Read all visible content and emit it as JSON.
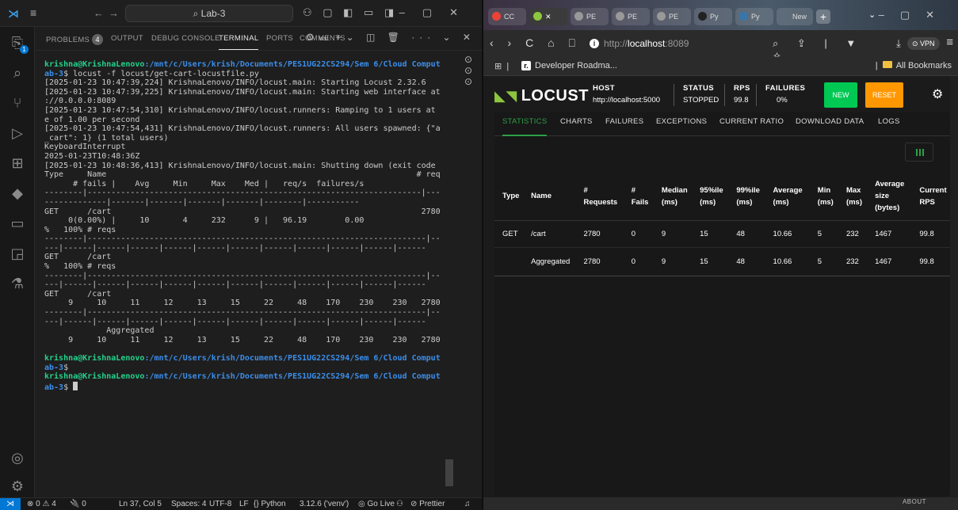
{
  "vscode": {
    "search": "Lab-3",
    "panel_tabs": [
      {
        "label": "PROBLEMS",
        "badge": "4"
      },
      {
        "label": "OUTPUT"
      },
      {
        "label": "DEBUG CONSOLE"
      },
      {
        "label": "TERMINAL"
      },
      {
        "label": "PORTS"
      },
      {
        "label": "COMMENTS"
      }
    ],
    "terminal_shell": "wsl",
    "prompt_user": "krishna@KrishnaLenovo",
    "prompt_path": ":/mnt/c/Users/krish/Documents/PES1UG22CS294/Sem 6/Cloud Computing/L",
    "prompt_path_cont": "ab-3",
    "prompt_suffix": "$ ",
    "command": "locust -f locust/get-cart-locustfile.py",
    "output_lines": [
      "[2025-01-23 10:47:39,224] KrishnaLenovo/INFO/locust.main: Starting Locust 2.32.6",
      "[2025-01-23 10:47:39,225] KrishnaLenovo/INFO/locust.main: Starting web interface at http",
      "://0.0.0.0:8089",
      "[2025-01-23 10:47:54,310] KrishnaLenovo/INFO/locust.runners: Ramping to 1 users at a rat",
      "e of 1.00 per second",
      "[2025-01-23 10:47:54,431] KrishnaLenovo/INFO/locust.runners: All users spawned: {\"add_to",
      "_cart\": 1} (1 total users)",
      "KeyboardInterrupt",
      "2025-01-23T10:48:36Z",
      "[2025-01-23 10:48:36,413] KrishnaLenovo/INFO/locust.main: Shutting down (exit code 0)",
      "Type     Name                                                                 # reqs",
      "      # fails |    Avg     Min     Max    Med |   req/s  failures/s",
      "--------|----------------------------------------------------------------------|-------|",
      "-------------|-------|-------|-------|-------|--------|-----------",
      "GET      /cart                                                                 2780",
      "     0(0.00%) |     10       4     232      9 |   96.19        0.00",
      "%   100% # reqs",
      "--------|-----------------------------------------------------------------------|----",
      "---|------|------|------|------|------|------|------|------|------|------|------",
      "GET      /cart",
      "%   100% # reqs",
      "--------|-----------------------------------------------------------------------|----",
      "---|------|------|------|------|------|------|------|------|------|------|------",
      "GET      /cart",
      "     9     10     11     12     13     15     22     48    170    230    230   2780",
      "--------|-----------------------------------------------------------------------|----",
      "---|------|------|------|------|------|------|------|------|------|------|------",
      "             Aggregated",
      "     9     10     11     12     13     15     22     48    170    230    230   2780"
    ],
    "status_bar": {
      "problems": "⊗ 0 ⚠ 4",
      "ports": "🔌 0",
      "position": "Ln 37, Col 5",
      "spaces": "Spaces: 4",
      "encoding": "UTF-8",
      "eol": "LF",
      "language": "{} Python",
      "python_version": "3.12.6 ('venv')",
      "golive": "Go Live",
      "prettier": "Prettier"
    }
  },
  "browser": {
    "tabs": [
      "CC",
      "",
      "PE",
      "PE",
      "PE",
      "Py",
      "Py",
      "New Ta"
    ],
    "url_prefix": "http://",
    "url_host": "localhost",
    "url_port": ":8089",
    "vpn": "VPN",
    "bookmark": "Developer Roadma...",
    "all_bookmarks": "All Bookmarks",
    "scroll_footer": "ABOUT"
  },
  "locust": {
    "brand": "LOCUST",
    "host_label": "HOST",
    "host": "http://localhost:5000",
    "status_label": "STATUS",
    "status": "STOPPED",
    "rps_label": "RPS",
    "rps": "99.8",
    "failures_label": "FAILURES",
    "failures": "0%",
    "new_btn": "NEW",
    "reset_btn": "RESET",
    "tabs": [
      "STATISTICS",
      "CHARTS",
      "FAILURES",
      "EXCEPTIONS",
      "CURRENT RATIO",
      "DOWNLOAD DATA",
      "LOGS"
    ],
    "columns": [
      "Type",
      "Name",
      "# Requests",
      "# Fails",
      "Median (ms)",
      "95%ile (ms)",
      "99%ile (ms)",
      "Average (ms)",
      "Min (ms)",
      "Max (ms)",
      "Average size (bytes)",
      "Current RPS"
    ],
    "rows": [
      [
        "GET",
        "/cart",
        "2780",
        "0",
        "9",
        "15",
        "48",
        "10.66",
        "5",
        "232",
        "1467",
        "99.8"
      ],
      [
        "",
        "Aggregated",
        "2780",
        "0",
        "9",
        "15",
        "48",
        "10.66",
        "5",
        "232",
        "1467",
        "99.8"
      ]
    ]
  }
}
